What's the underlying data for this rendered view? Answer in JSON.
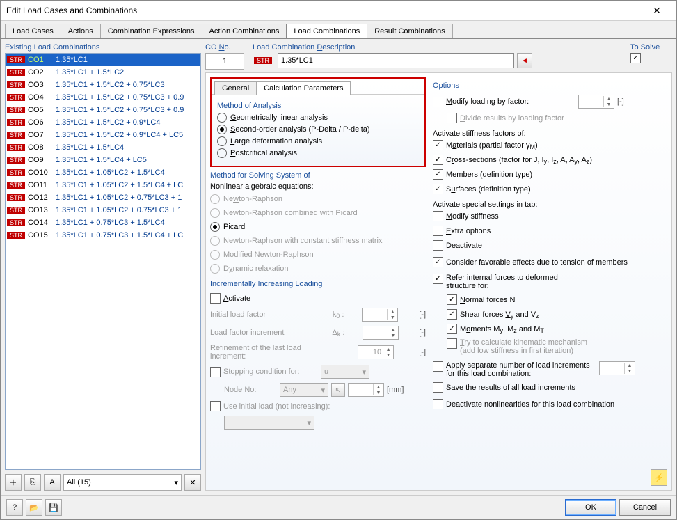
{
  "window": {
    "title": "Edit Load Cases and Combinations"
  },
  "tabs": [
    "Load Cases",
    "Actions",
    "Combination Expressions",
    "Action Combinations",
    "Load Combinations",
    "Result Combinations"
  ],
  "active_tab": 4,
  "left": {
    "title": "Existing Load Combinations",
    "items": [
      {
        "badge": "STR",
        "id": "CO1",
        "expr": "1.35*LC1"
      },
      {
        "badge": "STR",
        "id": "CO2",
        "expr": "1.35*LC1 + 1.5*LC2"
      },
      {
        "badge": "STR",
        "id": "CO3",
        "expr": "1.35*LC1 + 1.5*LC2 + 0.75*LC3"
      },
      {
        "badge": "STR",
        "id": "CO4",
        "expr": "1.35*LC1 + 1.5*LC2 + 0.75*LC3 + 0.9"
      },
      {
        "badge": "STR",
        "id": "CO5",
        "expr": "1.35*LC1 + 1.5*LC2 + 0.75*LC3 + 0.9"
      },
      {
        "badge": "STR",
        "id": "CO6",
        "expr": "1.35*LC1 + 1.5*LC2 + 0.9*LC4"
      },
      {
        "badge": "STR",
        "id": "CO7",
        "expr": "1.35*LC1 + 1.5*LC2 + 0.9*LC4 + LC5"
      },
      {
        "badge": "STR",
        "id": "CO8",
        "expr": "1.35*LC1 + 1.5*LC4"
      },
      {
        "badge": "STR",
        "id": "CO9",
        "expr": "1.35*LC1 + 1.5*LC4 + LC5"
      },
      {
        "badge": "STR",
        "id": "CO10",
        "expr": "1.35*LC1 + 1.05*LC2 + 1.5*LC4"
      },
      {
        "badge": "STR",
        "id": "CO11",
        "expr": "1.35*LC1 + 1.05*LC2 + 1.5*LC4 + LC"
      },
      {
        "badge": "STR",
        "id": "CO12",
        "expr": "1.35*LC1 + 1.05*LC2 + 0.75*LC3 + 1"
      },
      {
        "badge": "STR",
        "id": "CO13",
        "expr": "1.35*LC1 + 1.05*LC2 + 0.75*LC3 + 1"
      },
      {
        "badge": "STR",
        "id": "CO14",
        "expr": "1.35*LC1 + 0.75*LC3 + 1.5*LC4"
      },
      {
        "badge": "STR",
        "id": "CO15",
        "expr": "1.35*LC1 + 0.75*LC3 + 1.5*LC4 + LC"
      }
    ],
    "filter_label": "All (15)"
  },
  "header": {
    "co_no_label": "CO No.",
    "co_no": "1",
    "desc_label": "Load Combination Description",
    "desc_badge": "STR",
    "desc": "1.35*LC1",
    "solve_label": "To Solve"
  },
  "subtabs": [
    "General",
    "Calculation Parameters"
  ],
  "active_subtab": 1,
  "method_analysis": {
    "title": "Method of Analysis",
    "opts": [
      "Geometrically linear analysis",
      "Second-order analysis (P-Delta / P-delta)",
      "Large deformation analysis",
      "Postcritical analysis"
    ],
    "underline": [
      "G",
      "S",
      "L",
      "P"
    ],
    "selected": 1
  },
  "method_solving": {
    "title": "Method for Solving System of",
    "subtitle": "Nonlinear algebraic equations:",
    "opts": [
      "Newton-Raphson",
      "Newton-Raphson combined with Picard",
      "Picard",
      "Newton-Raphson with constant stiffness matrix",
      "Modified Newton-Raphson",
      "Dynamic relaxation"
    ],
    "selected": 2
  },
  "incremental": {
    "title": "Incrementally Increasing Loading",
    "activate": "Activate",
    "initial": "Initial load factor",
    "initial_sym": "k0 :",
    "incr": "Load factor increment",
    "incr_sym": "Δk :",
    "refine": "Refinement of the last load increment:",
    "refine_val": "10",
    "stop": "Stopping condition for:",
    "stop_val": "u",
    "node": "Node No:",
    "node_val": "Any",
    "node_unit": "[mm]",
    "useinit": "Use initial load (not increasing):"
  },
  "options": {
    "title": "Options",
    "modify": "Modify loading by factor:",
    "modify_unit": "[-]",
    "divide": "Divide results by loading factor",
    "stiff_title": "Activate stiffness factors of:",
    "materials": "Materials (partial factor γM)",
    "cross": "Cross-sections (factor for J, Iy, Iz, A, Ay, Az)",
    "members": "Members (definition type)",
    "surfaces": "Surfaces (definition type)",
    "special_title": "Activate special settings in tab:",
    "modstiff": "Modify stiffness",
    "extra": "Extra options",
    "deact": "Deactivate",
    "tension": "Consider favorable effects due to tension of members",
    "refer": "Refer internal forces to deformed structure for:",
    "normal": "Normal forces N",
    "shear": "Shear forces Vy and Vz",
    "moments": "Moments My, Mz and MT",
    "kinematic": "Try to calculate kinematic mechanism (add low stiffness in first iteration)",
    "separate": "Apply separate number of load increments for this load combination:",
    "saveres": "Save the results of all load increments",
    "deact_nl": "Deactivate nonlinearities for this load combination"
  },
  "footer": {
    "ok": "OK",
    "cancel": "Cancel"
  }
}
